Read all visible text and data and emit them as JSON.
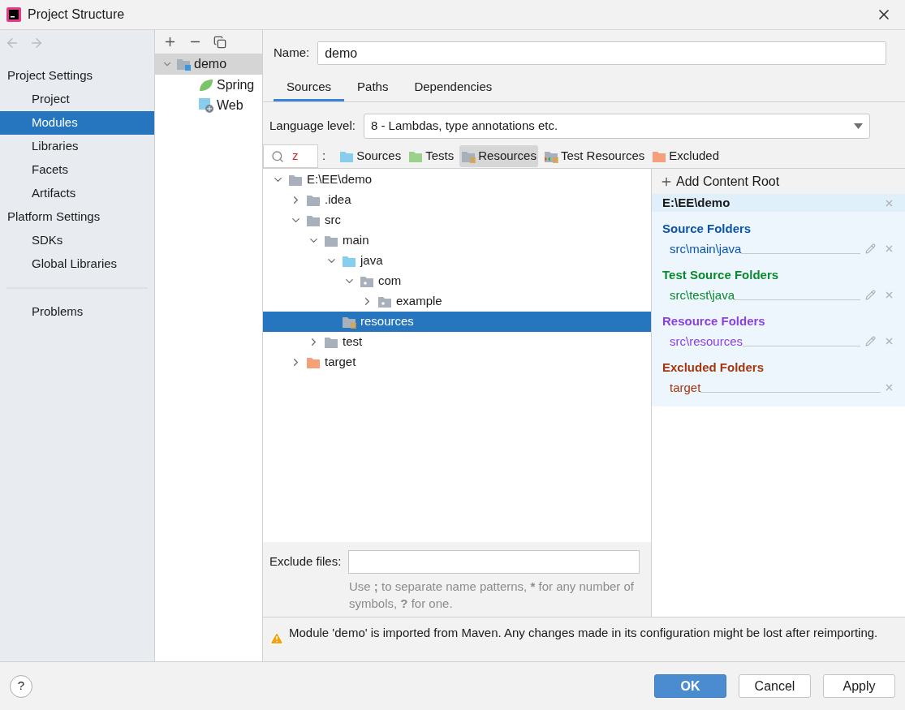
{
  "window": {
    "title": "Project Structure"
  },
  "sidebar": {
    "sections": [
      {
        "heading": "Project Settings",
        "items": [
          {
            "label": "Project",
            "selected": false
          },
          {
            "label": "Modules",
            "selected": true
          },
          {
            "label": "Libraries",
            "selected": false
          },
          {
            "label": "Facets",
            "selected": false
          },
          {
            "label": "Artifacts",
            "selected": false
          }
        ]
      },
      {
        "heading": "Platform Settings",
        "items": [
          {
            "label": "SDKs",
            "selected": false
          },
          {
            "label": "Global Libraries",
            "selected": false
          }
        ]
      }
    ],
    "extra_items": [
      {
        "label": "Problems",
        "selected": false
      }
    ]
  },
  "modules": [
    {
      "label": "demo",
      "kind": "module",
      "expanded": true,
      "selected": true,
      "children": [
        {
          "label": "Spring",
          "kind": "spring",
          "selected": false
        },
        {
          "label": "Web",
          "kind": "web",
          "selected": false
        }
      ]
    }
  ],
  "name_field": {
    "label": "Name:",
    "value": "demo"
  },
  "tabs": [
    {
      "label": "Sources",
      "selected": true
    },
    {
      "label": "Paths",
      "selected": false
    },
    {
      "label": "Dependencies",
      "selected": false
    }
  ],
  "language_level": {
    "label": "Language level:",
    "value": "8 - Lambdas, type annotations etc."
  },
  "search": {
    "value": "z"
  },
  "mark_as": {
    "label": ":",
    "buttons": [
      {
        "label": "Sources",
        "kind": "source",
        "selected": false
      },
      {
        "label": "Tests",
        "kind": "test",
        "selected": false
      },
      {
        "label": "Resources",
        "kind": "resource",
        "selected": true
      },
      {
        "label": "Test Resources",
        "kind": "test_resource",
        "selected": false
      },
      {
        "label": "Excluded",
        "kind": "excluded",
        "selected": false
      }
    ]
  },
  "tree": [
    {
      "label": "E:\\EE\\demo",
      "kind": "folder",
      "expanded": true,
      "selected": false,
      "children": [
        {
          "label": ".idea",
          "kind": "folder",
          "expanded": false,
          "selected": false
        },
        {
          "label": "src",
          "kind": "folder",
          "expanded": true,
          "selected": false,
          "children": [
            {
              "label": "main",
              "kind": "folder",
              "expanded": true,
              "selected": false,
              "children": [
                {
                  "label": "java",
                  "kind": "source",
                  "expanded": true,
                  "selected": false,
                  "children": [
                    {
                      "label": "com",
                      "kind": "package",
                      "expanded": true,
                      "selected": false,
                      "children": [
                        {
                          "label": "example",
                          "kind": "package",
                          "expanded": false,
                          "selected": false
                        }
                      ]
                    }
                  ]
                },
                {
                  "label": "resources",
                  "kind": "resource",
                  "selected": true
                }
              ]
            },
            {
              "label": "test",
              "kind": "folder",
              "expanded": false,
              "selected": false
            }
          ]
        },
        {
          "label": "target",
          "kind": "excluded",
          "expanded": false,
          "selected": false
        }
      ]
    }
  ],
  "content_root": {
    "add_label": "Add Content Root",
    "path": "E:\\EE\\demo",
    "groups": [
      {
        "title": "Source Folders",
        "color": "#0b55a8",
        "folders": [
          {
            "path": "src\\main\\java",
            "editable": true
          }
        ]
      },
      {
        "title": "Test Source Folders",
        "color": "#0a8a2e",
        "folders": [
          {
            "path": "src\\test\\java",
            "editable": true
          }
        ]
      },
      {
        "title": "Resource Folders",
        "color": "#8a3ee8",
        "folders": [
          {
            "path": "src\\resources",
            "editable": true
          }
        ]
      },
      {
        "title": "Excluded Folders",
        "color": "#a3370e",
        "folders": [
          {
            "path": "target",
            "editable": false
          }
        ]
      }
    ]
  },
  "exclude_files": {
    "label": "Exclude files:",
    "hint": "Use **;** to separate name patterns, ***** for any number of symbols, **?** for one."
  },
  "warning": "Module 'demo' is imported from Maven. Any changes made in its configuration might be lost after reimporting.",
  "buttons": [
    {
      "label": "OK",
      "kind": "primary"
    },
    {
      "label": "Cancel",
      "kind": "secondary"
    },
    {
      "label": "Apply",
      "kind": "secondary"
    }
  ],
  "help_button": "?"
}
